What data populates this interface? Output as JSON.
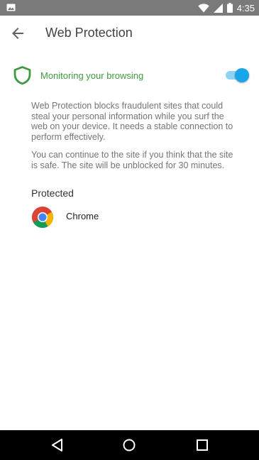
{
  "status_bar": {
    "time": "4:35",
    "icons": [
      "gallery-icon",
      "wifi-icon",
      "signal-icon",
      "battery-icon"
    ]
  },
  "header": {
    "title": "Web Protection",
    "back_icon": "arrow-back-icon"
  },
  "monitoring": {
    "label": "Monitoring your browsing",
    "enabled": true,
    "icon": "shield-icon",
    "label_color": "#3d9a3d",
    "toggle_color": "#17a6ea"
  },
  "description": {
    "paragraph1": "Web Protection blocks fraudulent sites that could steal your personal information while you surf the web on your device. It needs a stable connection to perform effectively.",
    "paragraph2": "You can continue to the site if you think that the site is safe. The site will be unblocked for 30 minutes."
  },
  "protected": {
    "section_title": "Protected",
    "apps": [
      {
        "name": "Chrome",
        "icon": "chrome-icon"
      }
    ]
  },
  "nav_bar": {
    "icons": [
      "nav-back-icon",
      "nav-home-icon",
      "nav-recents-icon"
    ]
  }
}
